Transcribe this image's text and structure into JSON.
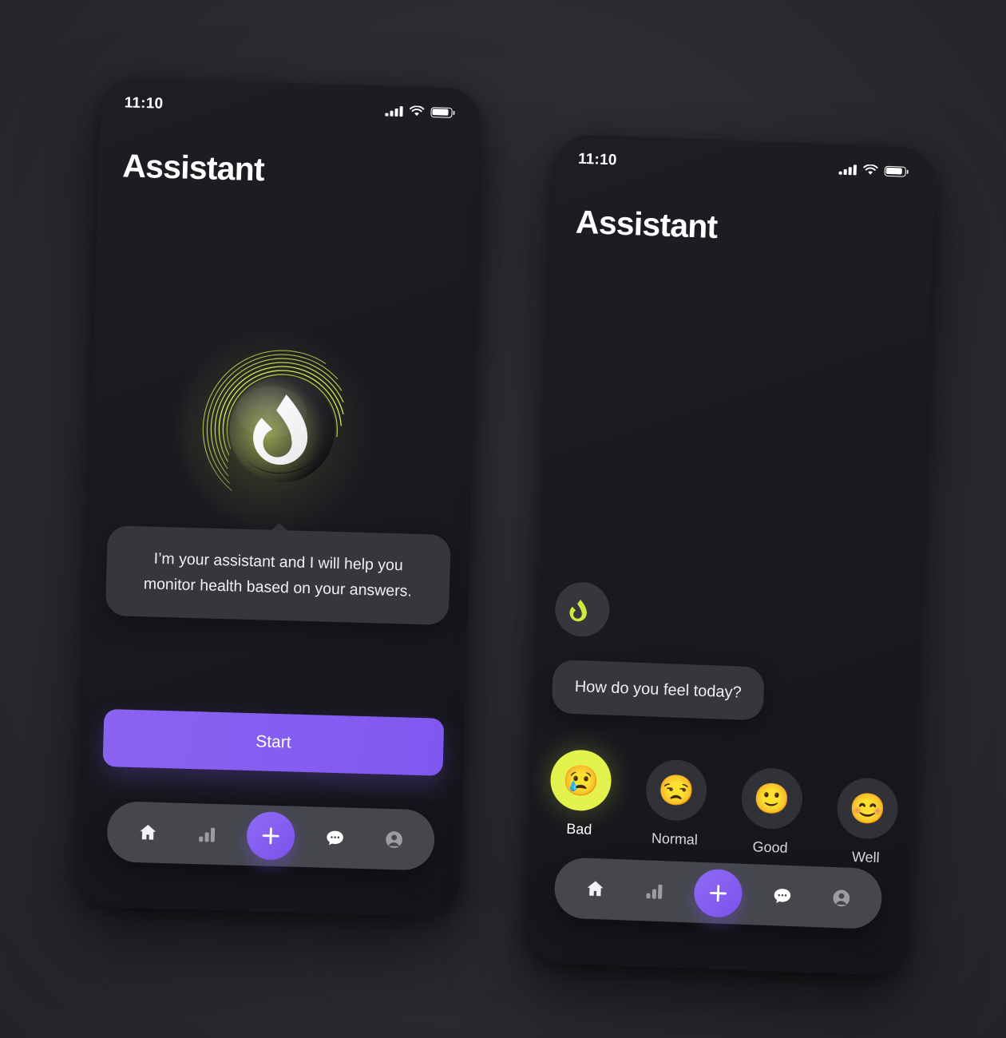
{
  "page": {
    "background_color": "#2b2d33",
    "accent_purple": "#7c52ec",
    "accent_lime": "#e3f24d",
    "surface_color": "#35373d",
    "screen_color": "#1b1c22"
  },
  "status_bar": {
    "time": "11:10",
    "cellular_icon": "signal-bars-icon",
    "wifi_icon": "wifi-icon",
    "battery_icon": "battery-icon"
  },
  "screen_1": {
    "title": "Assistant",
    "logo_icon": "assistant-flame-orb-icon",
    "bubble_text": "I’m your assistant and I will help you monitor health based on your answers.",
    "start_label": "Start"
  },
  "screen_2": {
    "title": "Assistant",
    "avatar_icon": "assistant-flame-icon",
    "message": "How do you feel today?",
    "moods": [
      {
        "emoji": "😢",
        "label": "Bad",
        "icon": "crying-face-icon",
        "selected": true
      },
      {
        "emoji": "😒",
        "label": "Normal",
        "icon": "unamused-face-icon",
        "selected": false
      },
      {
        "emoji": "🙂",
        "label": "Good",
        "icon": "slight-smile-icon",
        "selected": false
      },
      {
        "emoji": "😊",
        "label": "Well",
        "icon": "smiling-face-icon",
        "selected": false
      }
    ]
  },
  "nav_bar": {
    "items": [
      {
        "icon": "home-icon",
        "active": true
      },
      {
        "icon": "bar-chart-icon",
        "active": false
      },
      {
        "icon": "plus-icon",
        "active": false
      },
      {
        "icon": "chat-bubble-icon",
        "active": true
      },
      {
        "icon": "profile-icon",
        "active": false
      }
    ]
  }
}
